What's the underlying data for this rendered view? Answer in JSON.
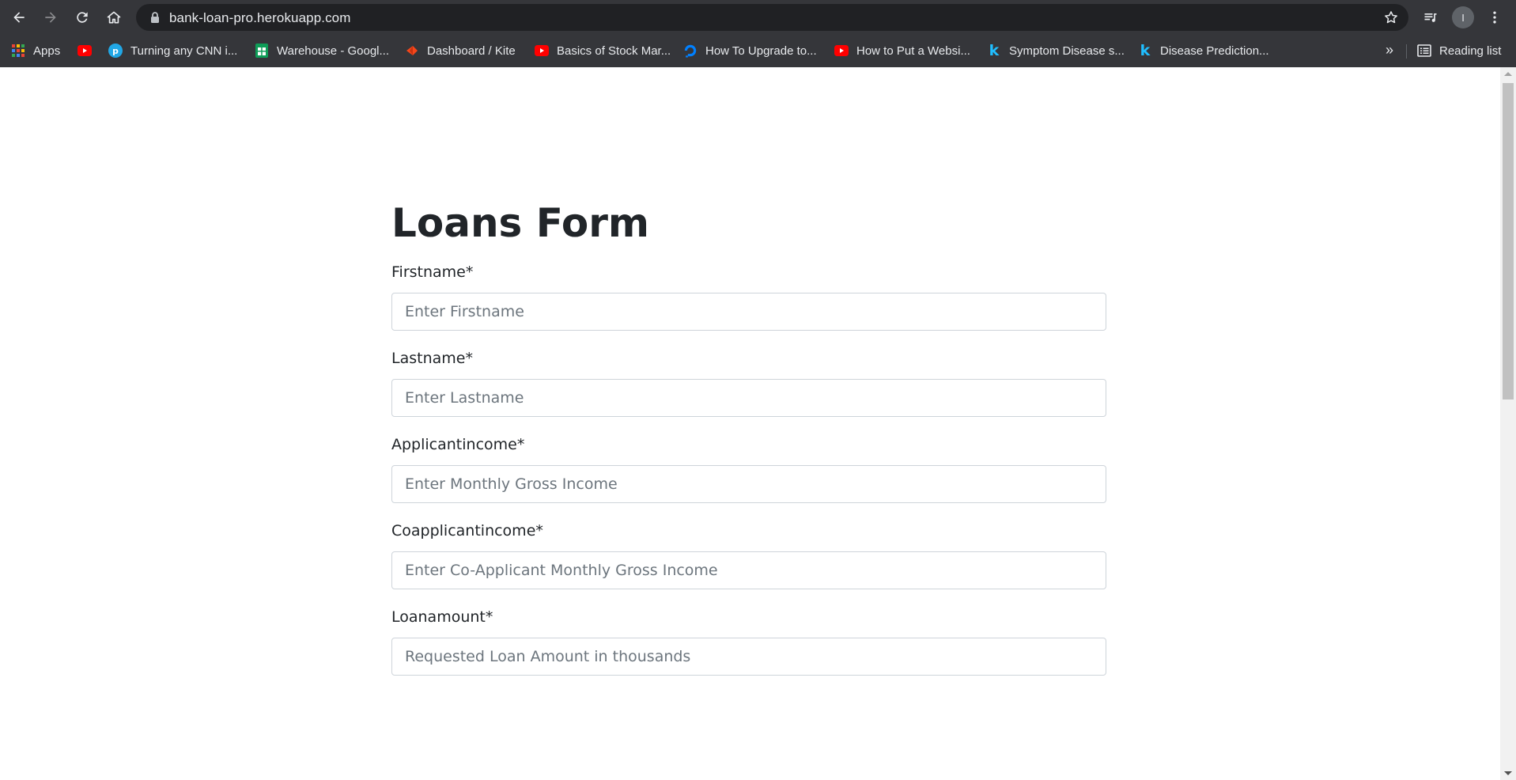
{
  "browser": {
    "url": "bank-loan-pro.herokuapp.com",
    "profile_initial": "I",
    "bookmarks": [
      {
        "label": "Apps",
        "icon": "apps-grid-icon"
      },
      {
        "label": "",
        "icon": "youtube-icon"
      },
      {
        "label": "Turning any CNN i...",
        "icon": "paperswithcode-icon"
      },
      {
        "label": "Warehouse - Googl...",
        "icon": "google-sheets-icon"
      },
      {
        "label": "Dashboard / Kite",
        "icon": "kite-icon"
      },
      {
        "label": "Basics of Stock Mar...",
        "icon": "youtube-icon"
      },
      {
        "label": "How To Upgrade to...",
        "icon": "digitalocean-icon"
      },
      {
        "label": "How to Put a Websi...",
        "icon": "youtube-icon"
      },
      {
        "label": "Symptom Disease s...",
        "icon": "kaggle-icon"
      },
      {
        "label": "Disease Prediction...",
        "icon": "kaggle-icon"
      }
    ],
    "reading_list": "Reading list"
  },
  "form": {
    "title": "Loans Form",
    "fields": [
      {
        "label": "Firstname*",
        "placeholder": "Enter Firstname",
        "value": ""
      },
      {
        "label": "Lastname*",
        "placeholder": "Enter Lastname",
        "value": ""
      },
      {
        "label": "Applicantincome*",
        "placeholder": "Enter Monthly Gross Income",
        "value": ""
      },
      {
        "label": "Coapplicantincome*",
        "placeholder": "Enter Co-Applicant Monthly Gross Income",
        "value": ""
      },
      {
        "label": "Loanamount*",
        "placeholder": "Requested Loan Amount in thousands",
        "value": ""
      }
    ]
  },
  "colors": {
    "chrome_bg": "#35363a",
    "omnibox_bg": "#202124",
    "text_dark": "#212529",
    "input_border": "#ced4da"
  }
}
